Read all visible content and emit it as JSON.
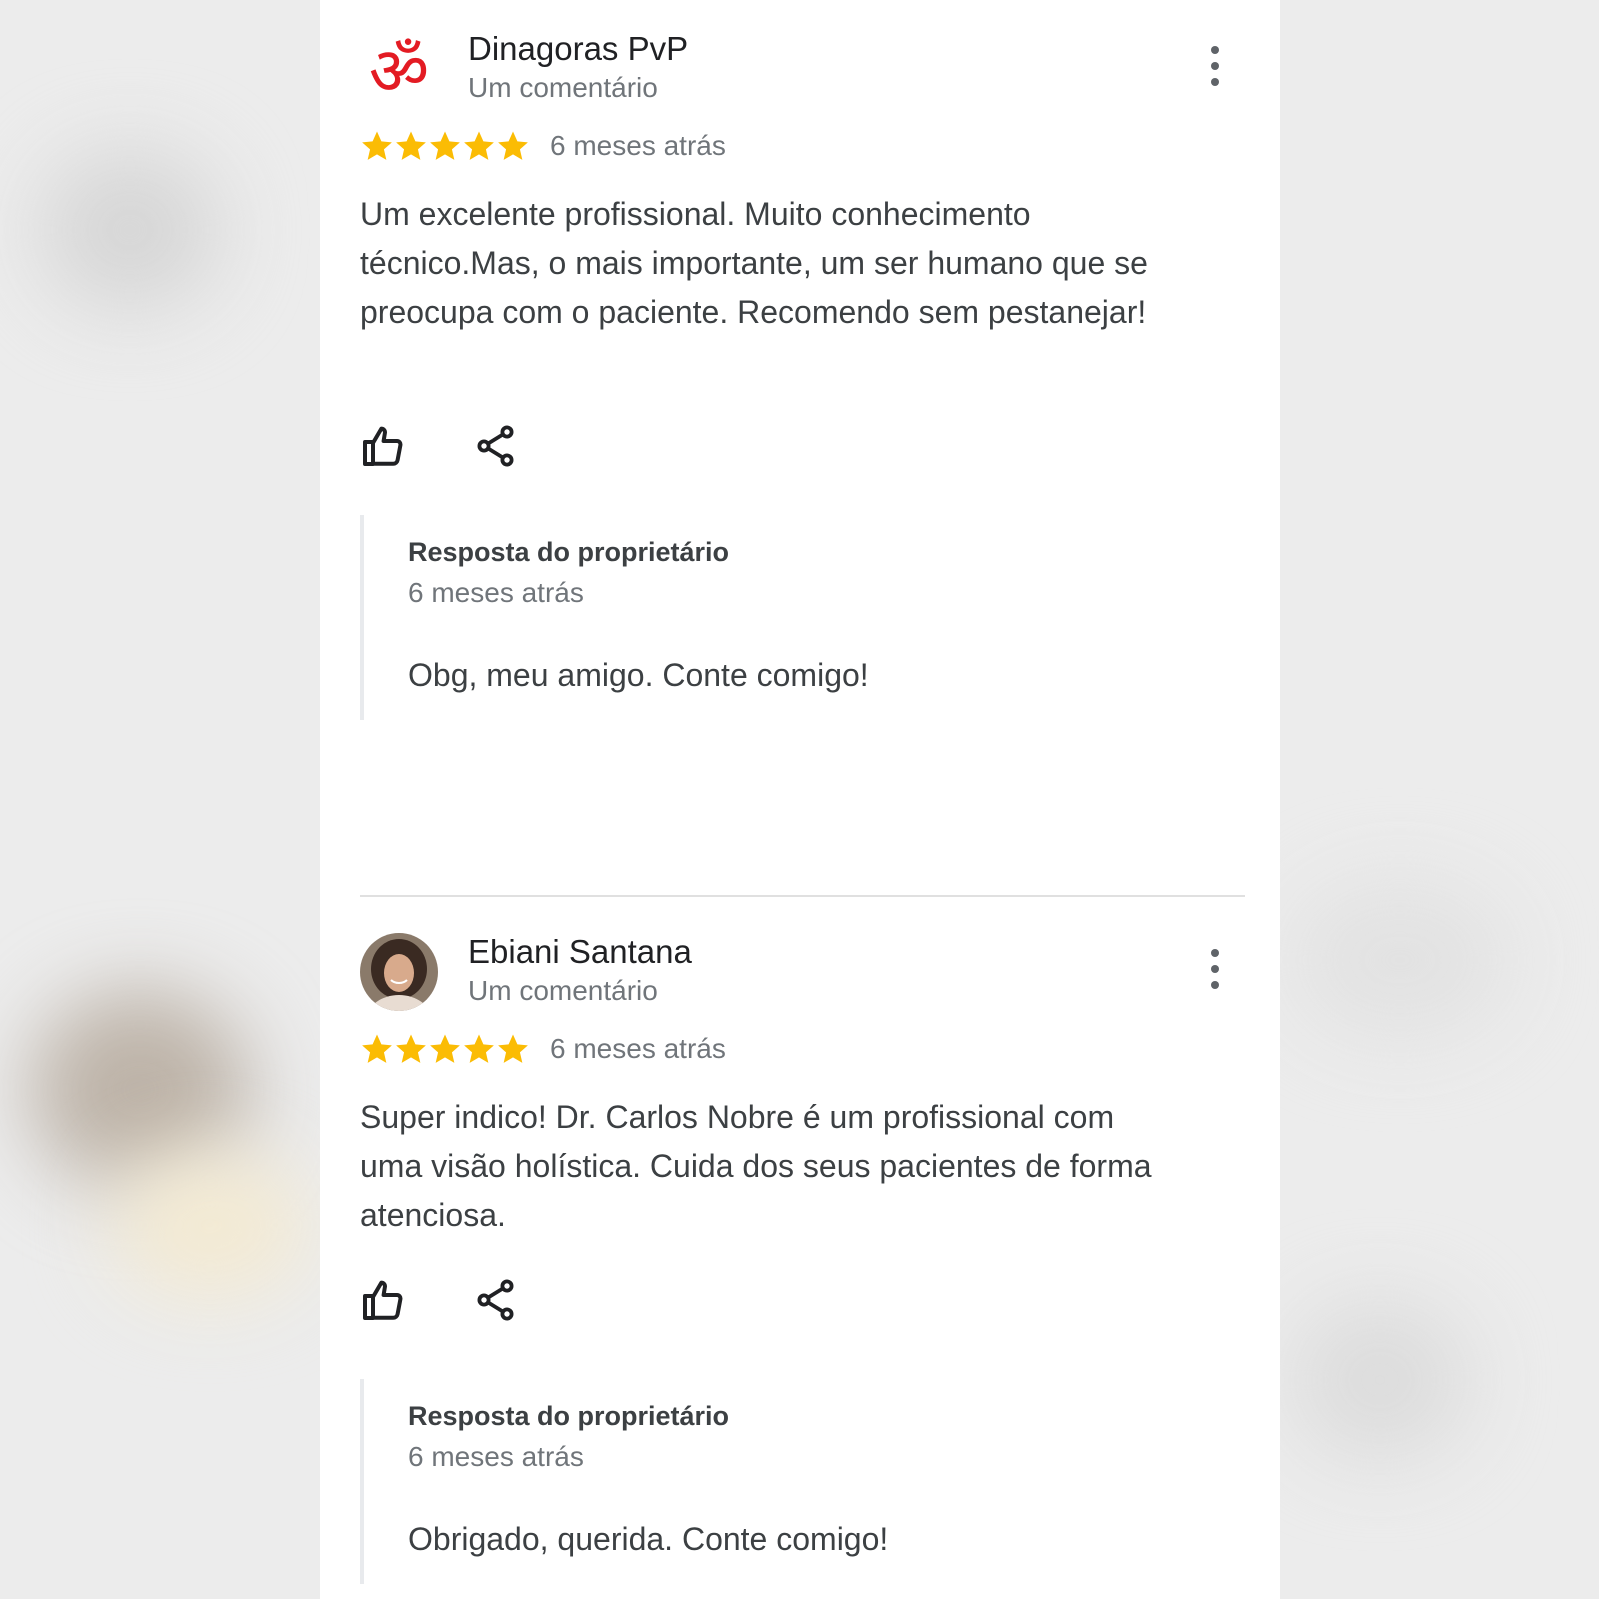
{
  "theme": {
    "star_color": "#fbbc04",
    "om_color": "#e31b23"
  },
  "reviews": [
    {
      "author": "Dinagoras PvP",
      "author_meta": "Um comentário",
      "avatar_icon": "om-symbol-icon",
      "rating": 5,
      "date": "6 meses atrás",
      "text": "Um excelente profissional. Muito conhecimento técnico.Mas, o mais importante, um ser humano que se preocupa com o paciente. Recomendo sem pestanejar!",
      "owner_reply": {
        "title": "Resposta do proprietário",
        "date": "6 meses atrás",
        "text": "Obg, meu amigo. Conte comigo!"
      }
    },
    {
      "author": "Ebiani Santana",
      "author_meta": "Um comentário",
      "avatar_icon": "profile-photo",
      "rating": 5,
      "date": "6 meses atrás",
      "text": "Super indico! Dr. Carlos Nobre é um profissional com uma visão holística.  Cuida dos seus pacientes de forma atenciosa.",
      "owner_reply": {
        "title": "Resposta do proprietário",
        "date": "6 meses atrás",
        "text": "Obrigado, querida. Conte comigo!"
      }
    }
  ]
}
